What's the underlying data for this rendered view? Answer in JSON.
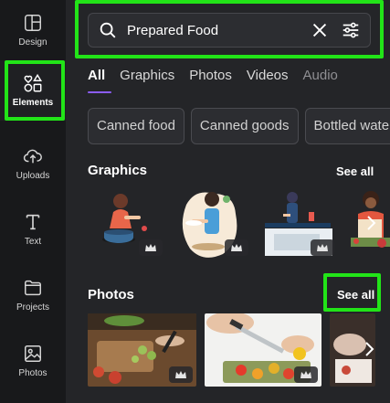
{
  "sidebar": {
    "items": [
      {
        "label": "Design",
        "icon": "design-icon"
      },
      {
        "label": "Elements",
        "icon": "elements-icon",
        "active": true
      },
      {
        "label": "Uploads",
        "icon": "upload-cloud-icon"
      },
      {
        "label": "Text",
        "icon": "text-icon"
      },
      {
        "label": "Projects",
        "icon": "folder-icon"
      },
      {
        "label": "Photos",
        "icon": "photo-icon"
      }
    ]
  },
  "search": {
    "value": "Prepared Food",
    "icon": "search-icon",
    "clear_icon": "close-icon",
    "filter_icon": "filter-sliders-icon"
  },
  "tabs": [
    {
      "label": "All",
      "active": true
    },
    {
      "label": "Graphics"
    },
    {
      "label": "Photos"
    },
    {
      "label": "Videos"
    },
    {
      "label": "Audio"
    }
  ],
  "suggestions": [
    "Canned food",
    "Canned goods",
    "Bottled water"
  ],
  "graphics": {
    "title": "Graphics",
    "see_all": "See all"
  },
  "photos": {
    "title": "Photos",
    "see_all": "See all"
  },
  "colors": {
    "highlight": "#22e418",
    "active_tab": "#8b5cf6",
    "panel_bg": "#242528",
    "rail_bg": "#18191b"
  }
}
